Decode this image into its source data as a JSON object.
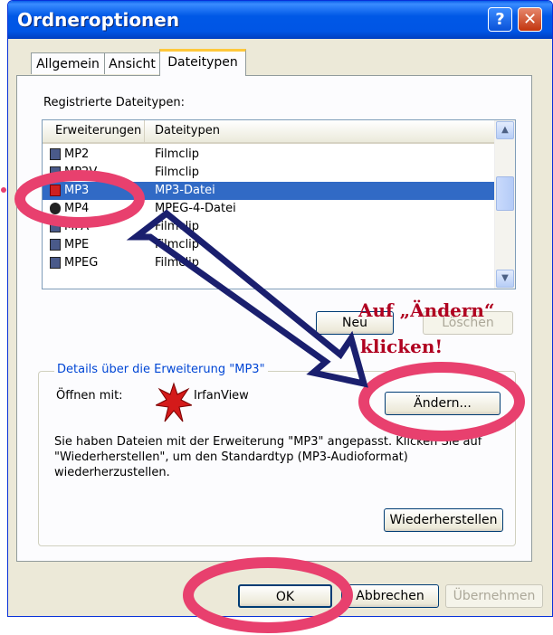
{
  "window": {
    "title": "Ordneroptionen",
    "help_glyph": "?",
    "close_glyph": "✕"
  },
  "tabs": [
    {
      "label": "Allgemein"
    },
    {
      "label": "Ansicht"
    },
    {
      "label": "Dateitypen"
    }
  ],
  "filetypes": {
    "section_label": "Registrierte Dateitypen:",
    "columns": {
      "ext": "Erweiterungen",
      "type": "Dateitypen"
    },
    "rows": [
      {
        "ext": "MP2",
        "type": "Filmclip",
        "icon": "film-icon"
      },
      {
        "ext": "MP2V",
        "type": "Filmclip",
        "icon": "film-icon"
      },
      {
        "ext": "MP3",
        "type": "MP3-Datei",
        "icon": "irfanview-icon",
        "selected": true
      },
      {
        "ext": "MP4",
        "type": "MPEG-4-Datei",
        "icon": "media-icon"
      },
      {
        "ext": "MPA",
        "type": "Filmclip",
        "icon": "film-icon"
      },
      {
        "ext": "MPE",
        "type": "Filmclip",
        "icon": "film-icon"
      },
      {
        "ext": "MPEG",
        "type": "Filmclip",
        "icon": "film-icon"
      }
    ],
    "scroll_up": "▲",
    "scroll_down": "▼"
  },
  "buttons": {
    "neu": "Neu",
    "loeschen": "Löschen",
    "aendern": "Ändern...",
    "wiederherstellen": "Wiederherstellen",
    "ok": "OK",
    "abbrechen": "Abbrechen",
    "uebernehmen": "Übernehmen"
  },
  "details": {
    "legend": "Details über die Erweiterung \"MP3\"",
    "open_with_label": "Öffnen mit:",
    "open_with_app": "IrfanView",
    "message": "Sie haben Dateien mit der Erweiterung \"MP3\" angepasst. Klicken Sie auf \"Wiederherstellen\", um den Standardtyp (MP3-Audioformat) wiederherzustellen."
  },
  "annotation": {
    "line1": "Auf „Ändern“",
    "line2": "klicken!",
    "accent_color": "#e8406e",
    "arrow_color": "#1a1f6e"
  }
}
